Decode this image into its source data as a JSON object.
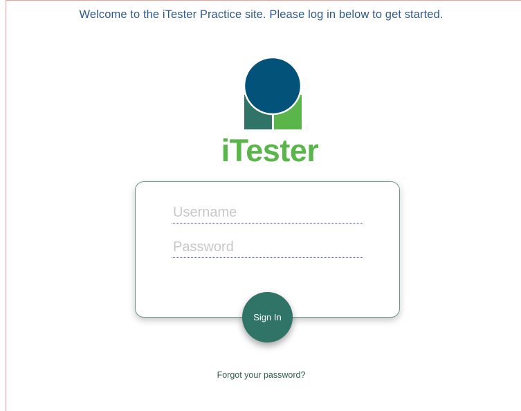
{
  "header": {
    "welcome_text": "Welcome to the iTester Practice site. Please log in below to get started."
  },
  "logo": {
    "text": "iTester",
    "icon": "itester-logo-icon",
    "colors": {
      "circle": "#03527a",
      "left_block": "#2f7466",
      "right_block": "#5ab54a",
      "text": "#5ab54a"
    }
  },
  "login_form": {
    "username_placeholder": "Username",
    "username_value": "",
    "password_placeholder": "Password",
    "password_value": "",
    "sign_in_label": "Sign In",
    "forgot_password_label": "Forgot your password?"
  },
  "colors": {
    "welcome_text": "#2f5a8c",
    "card_border": "#6b9a86",
    "button_bg": "#2f7466",
    "field_underline": "#2a3f9e",
    "link": "#2f5e52"
  }
}
